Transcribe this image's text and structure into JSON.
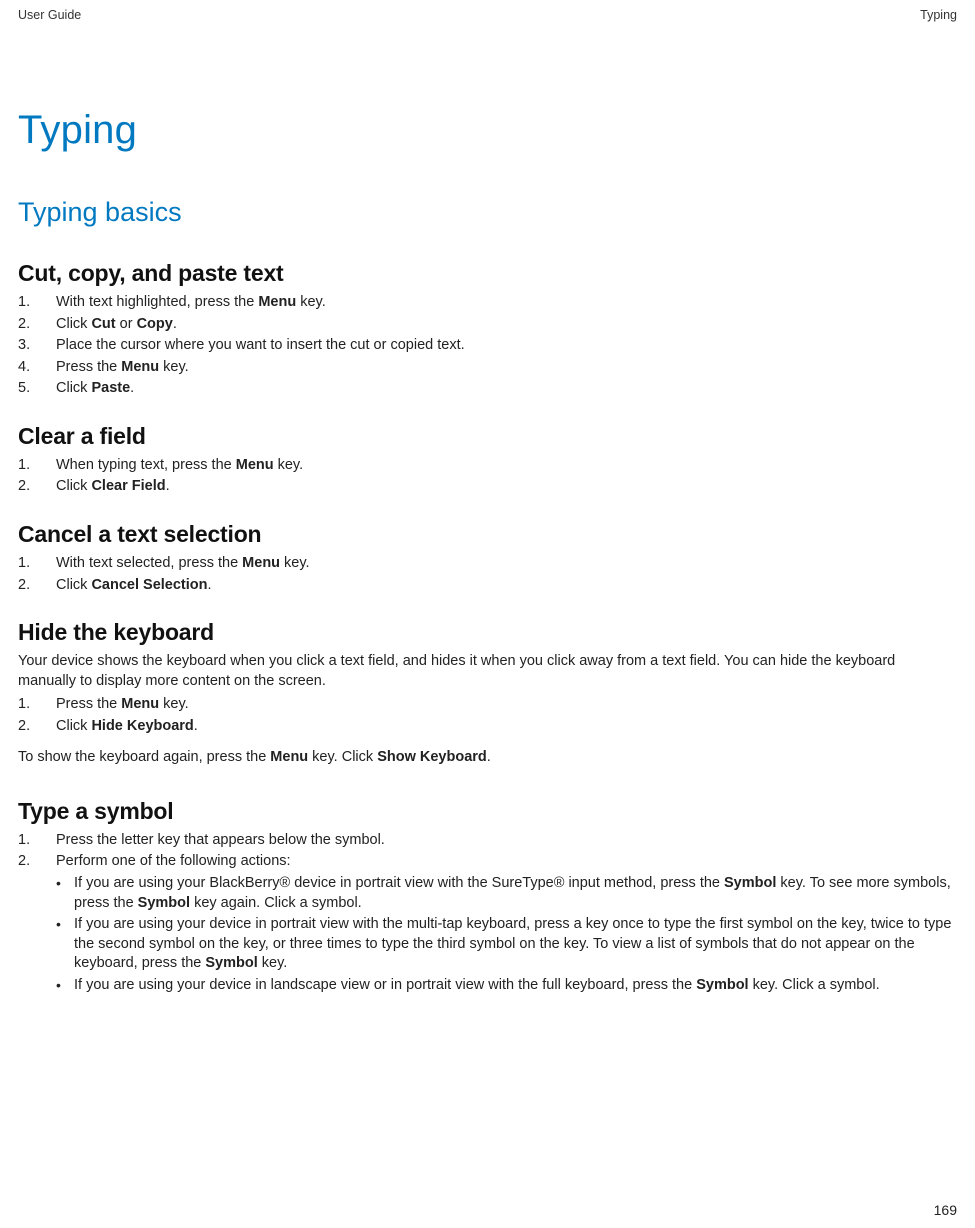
{
  "header": {
    "left": "User Guide",
    "right": "Typing"
  },
  "title": "Typing",
  "subtitle": "Typing basics",
  "sections": {
    "cut": {
      "heading": "Cut, copy, and paste text",
      "step1_pre": "With text highlighted, press the ",
      "step1_b": "Menu",
      "step1_post": " key.",
      "step2_pre": "Click ",
      "step2_b1": "Cut",
      "step2_mid": " or ",
      "step2_b2": "Copy",
      "step2_post": ".",
      "step3": "Place the cursor where you want to insert the cut or copied text.",
      "step4_pre": "Press the ",
      "step4_b": "Menu",
      "step4_post": " key.",
      "step5_pre": "Click ",
      "step5_b": "Paste",
      "step5_post": "."
    },
    "clear": {
      "heading": "Clear a field",
      "step1_pre": "When typing text, press the ",
      "step1_b": "Menu",
      "step1_post": " key.",
      "step2_pre": "Click ",
      "step2_b": "Clear Field",
      "step2_post": "."
    },
    "cancel": {
      "heading": "Cancel a text selection",
      "step1_pre": "With text selected, press the ",
      "step1_b": "Menu",
      "step1_post": " key.",
      "step2_pre": "Click ",
      "step2_b": "Cancel Selection",
      "step2_post": "."
    },
    "hide": {
      "heading": "Hide the keyboard",
      "intro": "Your device shows the keyboard when you click a text field, and hides it when you click away from a text field. You can hide the keyboard manually to display more content on the screen.",
      "step1_pre": "Press the ",
      "step1_b": "Menu",
      "step1_post": " key.",
      "step2_pre": "Click ",
      "step2_b": "Hide Keyboard",
      "step2_post": ".",
      "after_pre": "To show the keyboard again, press the ",
      "after_b1": "Menu",
      "after_mid": " key. Click ",
      "after_b2": "Show Keyboard",
      "after_post": "."
    },
    "symbol": {
      "heading": "Type a symbol",
      "step1": "Press the letter key that appears below the symbol.",
      "step2": "Perform one of the following actions:",
      "bullet1_pre": "If you are using your BlackBerry® device in portrait view with the SureType® input method, press the ",
      "bullet1_b1": "Symbol",
      "bullet1_mid": " key. To see more symbols, press the ",
      "bullet1_b2": "Symbol",
      "bullet1_post": " key again. Click a symbol.",
      "bullet2_pre": "If you are using your device in portrait view with the multi-tap keyboard, press a key once to type the first symbol on the key, twice to type the second symbol on the key, or three times to type the third symbol on the key. To view a list of symbols that do not appear on the keyboard, press the ",
      "bullet2_b": "Symbol",
      "bullet2_post": " key.",
      "bullet3_pre": "If you are using your device in landscape view or in portrait view with the full keyboard, press the ",
      "bullet3_b": "Symbol",
      "bullet3_post": " key. Click a symbol."
    }
  },
  "page_number": "169"
}
